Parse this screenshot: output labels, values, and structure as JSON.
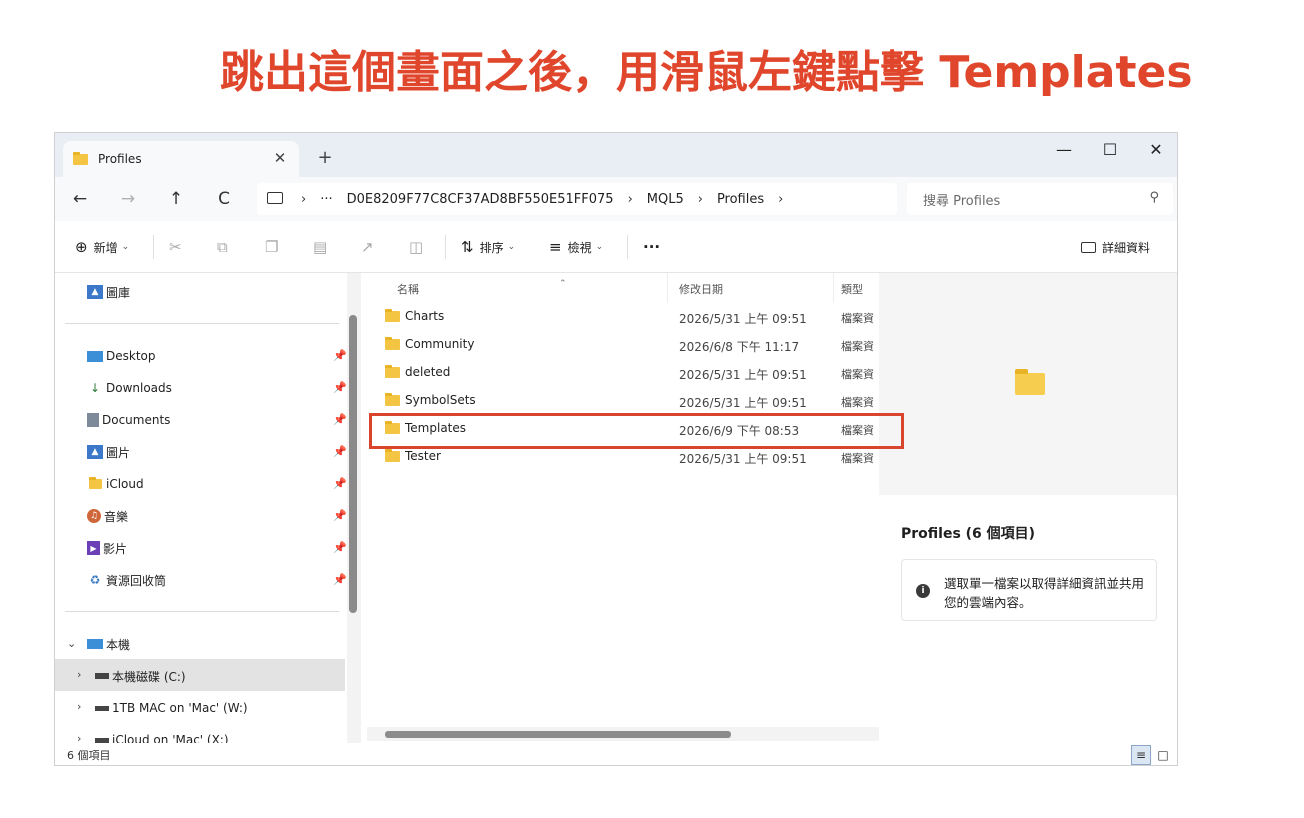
{
  "caption": "跳出這個畫面之後，用滑鼠左鍵點擊 Templates",
  "window": {
    "tab_title": "Profiles",
    "tab_close": "✕",
    "new_tab": "+",
    "controls": {
      "minimize": "—",
      "maximize": "☐",
      "close": "✕"
    }
  },
  "address": {
    "back": "←",
    "forward": "→",
    "up": "↑",
    "refresh": "C",
    "more": "···",
    "crumbs": [
      "D0E8209F77C8CF37AD8BF550E51FF075",
      "MQL5",
      "Profiles"
    ],
    "sep": "›",
    "search_placeholder": "搜尋 Profiles",
    "search_icon": "search-icon"
  },
  "toolbar": {
    "new_label": "新增",
    "sort_label": "排序",
    "view_label": "檢視",
    "more": "···",
    "details_label": "詳細資料"
  },
  "nav": {
    "gallery": "圖庫",
    "quick": [
      {
        "label": "Desktop"
      },
      {
        "label": "Downloads"
      },
      {
        "label": "Documents"
      },
      {
        "label": "圖片"
      },
      {
        "label": "iCloud"
      },
      {
        "label": "音樂"
      },
      {
        "label": "影片"
      },
      {
        "label": "資源回收筒"
      }
    ],
    "this_pc": "本機",
    "drives": [
      {
        "label": "本機磁碟 (C:)"
      },
      {
        "label": "1TB MAC on 'Mac' (W:)"
      },
      {
        "label": "iCloud on 'Mac' (X:)"
      }
    ]
  },
  "columns": {
    "name": "名稱",
    "date": "修改日期",
    "type": "類型"
  },
  "files": [
    {
      "name": "Charts",
      "date": "2026/5/31 上午 09:51",
      "type": "檔案資"
    },
    {
      "name": "Community",
      "date": "2026/6/8 下午 11:17",
      "type": "檔案資"
    },
    {
      "name": "deleted",
      "date": "2026/5/31 上午 09:51",
      "type": "檔案資"
    },
    {
      "name": "SymbolSets",
      "date": "2026/5/31 上午 09:51",
      "type": "檔案資"
    },
    {
      "name": "Templates",
      "date": "2026/6/9 下午 08:53",
      "type": "檔案資"
    },
    {
      "name": "Tester",
      "date": "2026/5/31 上午 09:51",
      "type": "檔案資"
    }
  ],
  "details": {
    "title": "Profiles (6 個項目)",
    "info": "選取單一檔案以取得詳細資訊並共用您的雲端內容。"
  },
  "status": {
    "count": "6 個項目"
  },
  "colors": {
    "caption": "#e0462c",
    "highlight": "#d9442c",
    "folder": "#f4c542"
  }
}
